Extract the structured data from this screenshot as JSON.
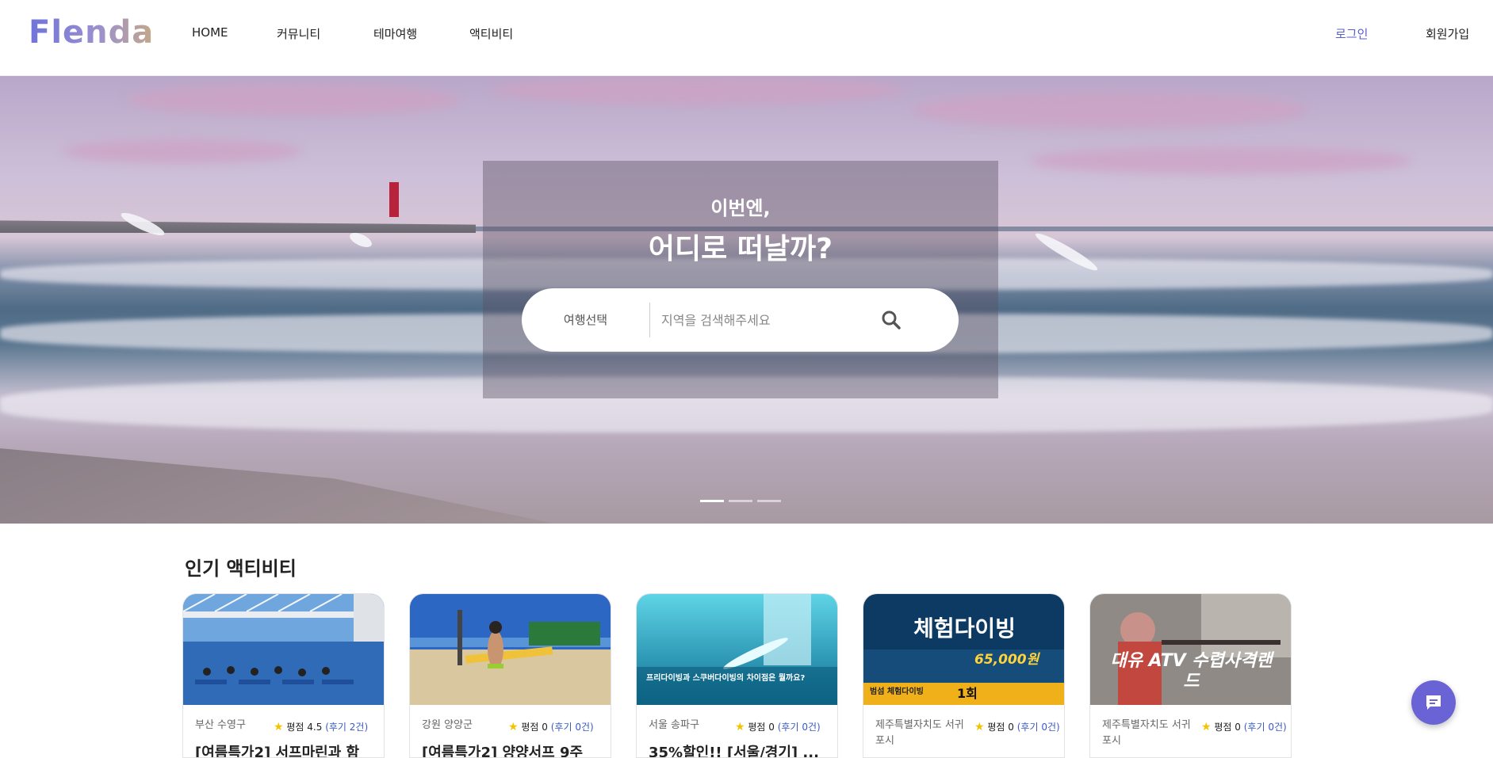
{
  "header": {
    "logo": "Flenda",
    "nav": [
      "HOME",
      "커뮤니티",
      "테마여행",
      "액티비티"
    ],
    "login": "로그인",
    "signup": "회원가입"
  },
  "hero": {
    "line1": "이번엔,",
    "line2": "어디로 떠날까?",
    "select_label": "여행선택",
    "search_placeholder": "지역을 검색해주세요",
    "slides": 3,
    "active_slide": 1
  },
  "popular": {
    "title": "인기 액티비티",
    "cards": [
      {
        "location": "부산 수영구",
        "rating_label": "평점 4.5",
        "reviews": "(후기 2건)",
        "title": "[여름특가2] 서프마린과 함"
      },
      {
        "location": "강원 양양군",
        "rating_label": "평점 0",
        "reviews": "(후기 0건)",
        "title": "[여름특가2] 양양서프 9주"
      },
      {
        "location": "서울 송파구",
        "rating_label": "평점 0",
        "reviews": "(후기 0건)",
        "title": "35%할인!! [서울/경기] ..."
      },
      {
        "location": "제주특별자치도 서귀포시",
        "rating_label": "평점 0",
        "reviews": "(후기 0건)",
        "title": ""
      },
      {
        "location": "제주특별자치도 서귀포시",
        "rating_label": "평점 0",
        "reviews": "(후기 0건)",
        "title": ""
      }
    ],
    "card_images": [
      {
        "caption": ""
      },
      {
        "caption": ""
      },
      {
        "caption": "프리다이빙과 스쿠버다이빙의 차이점은 뭘까요?"
      },
      {
        "caption": "체험다이빙",
        "sub": "범섬 체험다이빙",
        "price": "65,000원",
        "badge": "1회"
      },
      {
        "caption": "대유 ATV 수렵사격랜드"
      }
    ]
  },
  "colors": {
    "accent": "#5b5fc7",
    "chat_button": "#6a63d6",
    "star": "#f2c300",
    "review_link": "#3b5bc4"
  },
  "icons": [
    "search-icon",
    "star-icon",
    "chat-icon"
  ]
}
